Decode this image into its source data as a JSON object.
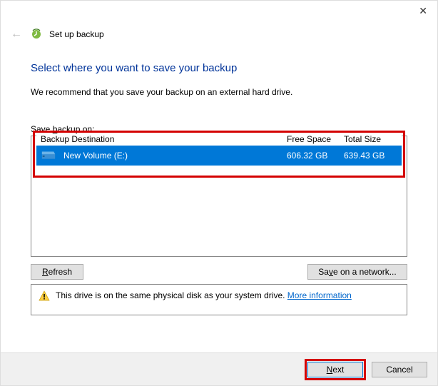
{
  "window": {
    "title": "Set up backup"
  },
  "page": {
    "heading": "Select where you want to save your backup",
    "recommendation": "We recommend that you save your backup on an external hard drive.",
    "save_label_pre": "Save ",
    "save_label_key": "b",
    "save_label_post": "ackup on:"
  },
  "table": {
    "headers": {
      "destination": "Backup Destination",
      "free": "Free Space",
      "total": "Total Size"
    },
    "row": {
      "name": "New Volume (E:)",
      "free": "606.32 GB",
      "total": "639.43 GB"
    }
  },
  "buttons": {
    "refresh_key": "R",
    "refresh_rest": "efresh",
    "network_pre": "Sa",
    "network_key": "v",
    "network_post": "e on a network...",
    "next_key": "N",
    "next_rest": "ext",
    "cancel": "Cancel"
  },
  "warning": {
    "text": "This drive is on the same physical disk as your system drive. ",
    "link": "More information"
  }
}
